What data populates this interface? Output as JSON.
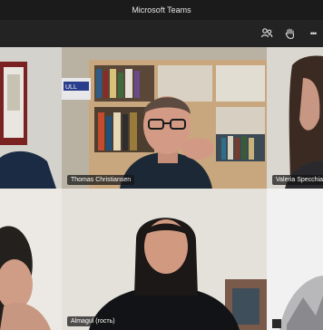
{
  "window": {
    "title": "Microsoft Teams"
  },
  "toolbar": {
    "icons": [
      "participants-icon",
      "raise-hand-icon",
      "more-options-icon"
    ],
    "more_label": "•••"
  },
  "participants": [
    {
      "name": "Thomas Christiansen"
    },
    {
      "name": "Valeria Specchia"
    },
    {
      "name": "Almagul (гость)"
    }
  ],
  "background_labels": {
    "banner_text": "ULL"
  }
}
